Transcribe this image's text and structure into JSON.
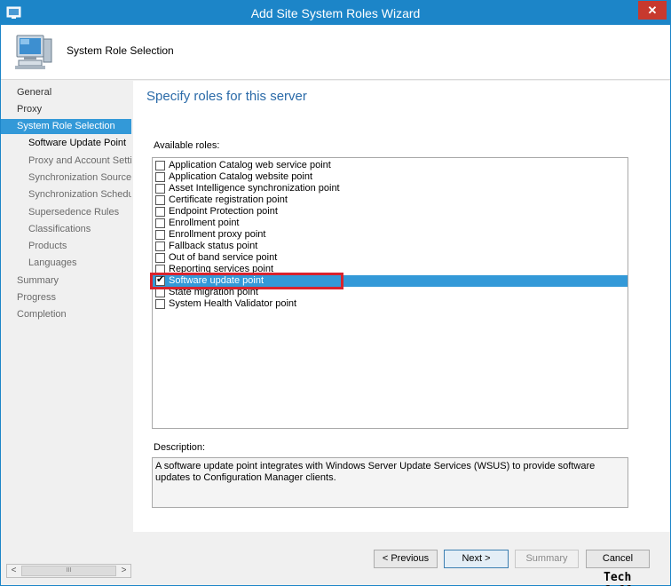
{
  "window": {
    "title": "Add Site System Roles Wizard",
    "close_glyph": "✕",
    "accent_color": "#1c85c8"
  },
  "header": {
    "title": "System Role Selection",
    "icon": "computer-icon"
  },
  "nav": {
    "items": [
      {
        "label": "General",
        "level": 0,
        "state": "normal"
      },
      {
        "label": "Proxy",
        "level": 0,
        "state": "normal"
      },
      {
        "label": "System Role Selection",
        "level": 0,
        "state": "active"
      },
      {
        "label": "Software Update Point",
        "level": 1,
        "state": "current"
      },
      {
        "label": "Proxy and Account Settings",
        "level": 1,
        "state": "normal"
      },
      {
        "label": "Synchronization Source",
        "level": 1,
        "state": "normal"
      },
      {
        "label": "Synchronization Schedule",
        "level": 1,
        "state": "normal"
      },
      {
        "label": "Supersedence Rules",
        "level": 1,
        "state": "normal"
      },
      {
        "label": "Classifications",
        "level": 1,
        "state": "normal"
      },
      {
        "label": "Products",
        "level": 1,
        "state": "normal"
      },
      {
        "label": "Languages",
        "level": 1,
        "state": "normal"
      },
      {
        "label": "Summary",
        "level": 0,
        "state": "dim"
      },
      {
        "label": "Progress",
        "level": 0,
        "state": "dim"
      },
      {
        "label": "Completion",
        "level": 0,
        "state": "dim"
      }
    ],
    "scroll_thumb": "III"
  },
  "main": {
    "heading": "Specify roles for this server",
    "available_label": "Available roles:",
    "roles": [
      {
        "label": "Application Catalog web service point",
        "checked": false,
        "selected": false
      },
      {
        "label": "Application Catalog website point",
        "checked": false,
        "selected": false
      },
      {
        "label": "Asset Intelligence synchronization point",
        "checked": false,
        "selected": false
      },
      {
        "label": "Certificate registration point",
        "checked": false,
        "selected": false
      },
      {
        "label": "Endpoint Protection point",
        "checked": false,
        "selected": false
      },
      {
        "label": "Enrollment point",
        "checked": false,
        "selected": false
      },
      {
        "label": "Enrollment proxy point",
        "checked": false,
        "selected": false
      },
      {
        "label": "Fallback status point",
        "checked": false,
        "selected": false
      },
      {
        "label": "Out of band service point",
        "checked": false,
        "selected": false
      },
      {
        "label": "Reporting services point",
        "checked": false,
        "selected": false
      },
      {
        "label": "Software update point",
        "checked": true,
        "selected": true
      },
      {
        "label": "State migration point",
        "checked": false,
        "selected": false
      },
      {
        "label": "System Health Validator point",
        "checked": false,
        "selected": false
      }
    ],
    "description_label": "Description:",
    "description_text": "A software update point integrates with Windows Server Update Services (WSUS) to provide software updates to Configuration Manager clients."
  },
  "buttons": {
    "previous": "< Previous",
    "next": "Next >",
    "summary": "Summary",
    "cancel": "Cancel"
  },
  "watermark": "Tech Coffee",
  "highlight_color": "#d9232d"
}
